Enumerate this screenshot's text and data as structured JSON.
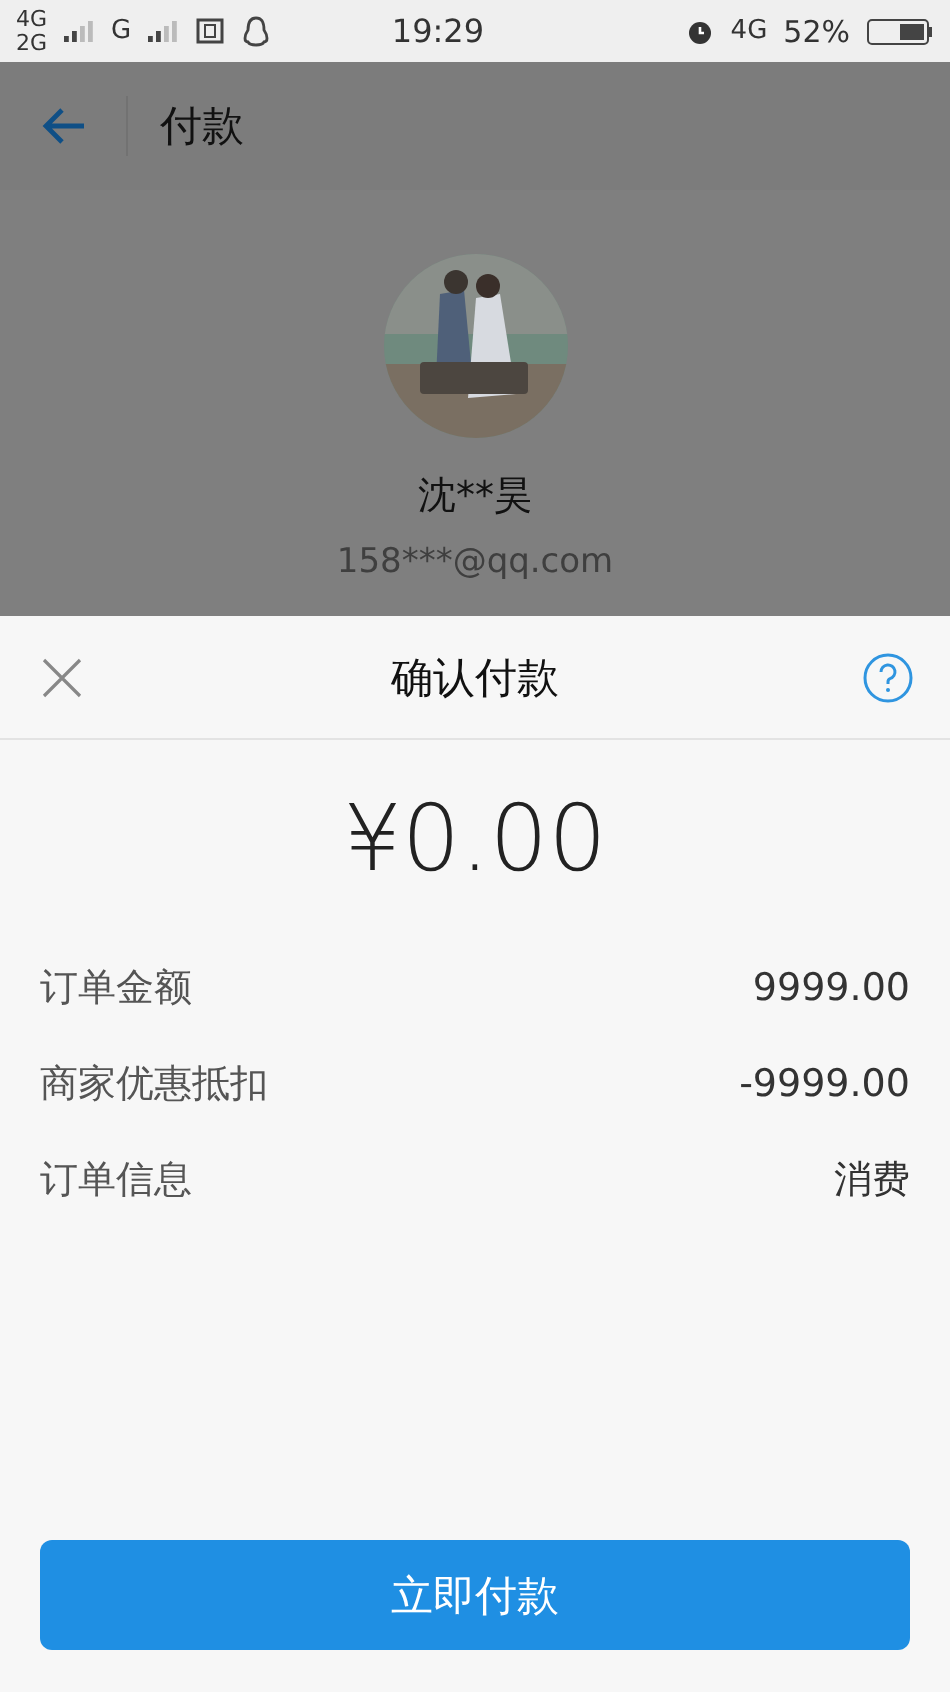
{
  "status_bar": {
    "sim_1": "4G",
    "sim_2": "2G",
    "network": "G",
    "time": "19:29",
    "network_right": "4G",
    "battery": "52%"
  },
  "header": {
    "title": "付款"
  },
  "payee": {
    "name": "沈**昊",
    "account": "158***@qq.com"
  },
  "sheet": {
    "title": "确认付款",
    "amount": "¥0.00",
    "rows": [
      {
        "label": "订单金额",
        "value": "9999.00"
      },
      {
        "label": "商家优惠抵扣",
        "value": "-9999.00"
      },
      {
        "label": "订单信息",
        "value": "消费"
      }
    ],
    "button": "立即付款"
  }
}
